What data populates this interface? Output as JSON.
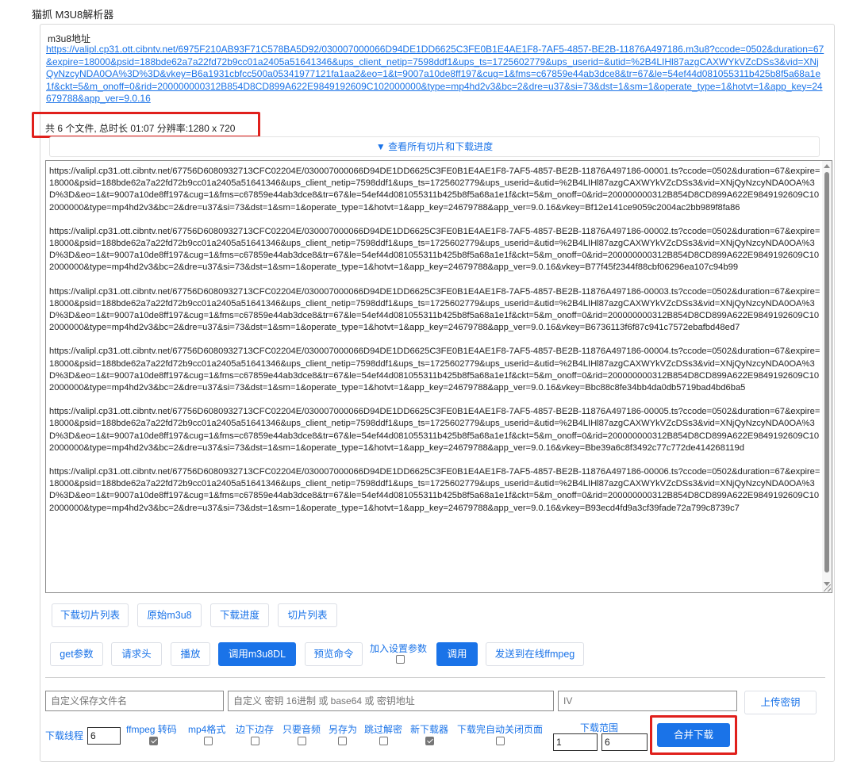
{
  "app": {
    "title": "猫抓 M3U8解析器"
  },
  "m3u8": {
    "label": "m3u8地址",
    "url": "https://valipl.cp31.ott.cibntv.net/6975F210AB93F71C578BA5D92/030007000066D94DE1DD6625C3FE0B1E4AE1F8-7AF5-4857-BE2B-11876A497186.m3u8?ccode=0502&duration=67&expire=18000&psid=188bde62a7a22fd72b9cc01a2405a51641346&ups_client_netip=7598ddf1&ups_ts=1725602779&ups_userid=&utid=%2B4LIHl87azgCAXWYkVZcDSs3&vid=XNjQyNzcyNDA0OA%3D%3D&vkey=B6a1931cbfcc500a05341977121fa1aa2&eo=1&t=9007a10de8ff197&cug=1&fms=c67859e44ab3dce8&tr=67&le=54ef44d081055311b425b8f5a68a1e1f&ckt=5&m_onoff=0&rid=200000000312B854D8CD899A622E9849192609C102000000&type=mp4hd2v3&bc=2&dre=u37&si=73&dst=1&sm=1&operate_type=1&hotvt=1&app_key=24679788&app_ver=9.0.16"
  },
  "summary": {
    "text": "共 6 个文件, 总时长 01:07 分辨率:1280 x 720"
  },
  "toggle": {
    "label": "▼ 查看所有切片和下载进度"
  },
  "segments": [
    "https://valipl.cp31.ott.cibntv.net/67756D6080932713CFC02204E/030007000066D94DE1DD6625C3FE0B1E4AE1F8-7AF5-4857-BE2B-11876A497186-00001.ts?ccode=0502&duration=67&expire=18000&psid=188bde62a7a22fd72b9cc01a2405a51641346&ups_client_netip=7598ddf1&ups_ts=1725602779&ups_userid=&utid=%2B4LIHl87azgCAXWYkVZcDSs3&vid=XNjQyNzcyNDA0OA%3D%3D&eo=1&t=9007a10de8ff197&cug=1&fms=c67859e44ab3dce8&tr=67&le=54ef44d081055311b425b8f5a68a1e1f&ckt=5&m_onoff=0&rid=200000000312B854D8CD899A622E9849192609C102000000&type=mp4hd2v3&bc=2&dre=u37&si=73&dst=1&sm=1&operate_type=1&hotvt=1&app_key=24679788&app_ver=9.0.16&vkey=Bf12e141ce9059c2004ac2bb989f8fa86",
    "https://valipl.cp31.ott.cibntv.net/67756D6080932713CFC02204E/030007000066D94DE1DD6625C3FE0B1E4AE1F8-7AF5-4857-BE2B-11876A497186-00002.ts?ccode=0502&duration=67&expire=18000&psid=188bde62a7a22fd72b9cc01a2405a51641346&ups_client_netip=7598ddf1&ups_ts=1725602779&ups_userid=&utid=%2B4LIHl87azgCAXWYkVZcDSs3&vid=XNjQyNzcyNDA0OA%3D%3D&eo=1&t=9007a10de8ff197&cug=1&fms=c67859e44ab3dce8&tr=67&le=54ef44d081055311b425b8f5a68a1e1f&ckt=5&m_onoff=0&rid=200000000312B854D8CD899A622E9849192609C102000000&type=mp4hd2v3&bc=2&dre=u37&si=73&dst=1&sm=1&operate_type=1&hotvt=1&app_key=24679788&app_ver=9.0.16&vkey=B77f45f2344f88cbf06296ea107c94b99",
    "https://valipl.cp31.ott.cibntv.net/67756D6080932713CFC02204E/030007000066D94DE1DD6625C3FE0B1E4AE1F8-7AF5-4857-BE2B-11876A497186-00003.ts?ccode=0502&duration=67&expire=18000&psid=188bde62a7a22fd72b9cc01a2405a51641346&ups_client_netip=7598ddf1&ups_ts=1725602779&ups_userid=&utid=%2B4LIHl87azgCAXWYkVZcDSs3&vid=XNjQyNzcyNDA0OA%3D%3D&eo=1&t=9007a10de8ff197&cug=1&fms=c67859e44ab3dce8&tr=67&le=54ef44d081055311b425b8f5a68a1e1f&ckt=5&m_onoff=0&rid=200000000312B854D8CD899A622E9849192609C102000000&type=mp4hd2v3&bc=2&dre=u37&si=73&dst=1&sm=1&operate_type=1&hotvt=1&app_key=24679788&app_ver=9.0.16&vkey=B6736113f6f87c941c7572ebafbd48ed7",
    "https://valipl.cp31.ott.cibntv.net/67756D6080932713CFC02204E/030007000066D94DE1DD6625C3FE0B1E4AE1F8-7AF5-4857-BE2B-11876A497186-00004.ts?ccode=0502&duration=67&expire=18000&psid=188bde62a7a22fd72b9cc01a2405a51641346&ups_client_netip=7598ddf1&ups_ts=1725602779&ups_userid=&utid=%2B4LIHl87azgCAXWYkVZcDSs3&vid=XNjQyNzcyNDA0OA%3D%3D&eo=1&t=9007a10de8ff197&cug=1&fms=c67859e44ab3dce8&tr=67&le=54ef44d081055311b425b8f5a68a1e1f&ckt=5&m_onoff=0&rid=200000000312B854D8CD899A622E9849192609C102000000&type=mp4hd2v3&bc=2&dre=u37&si=73&dst=1&sm=1&operate_type=1&hotvt=1&app_key=24679788&app_ver=9.0.16&vkey=Bbc88c8fe34bb4da0db5719bad4bd6ba5",
    "https://valipl.cp31.ott.cibntv.net/67756D6080932713CFC02204E/030007000066D94DE1DD6625C3FE0B1E4AE1F8-7AF5-4857-BE2B-11876A497186-00005.ts?ccode=0502&duration=67&expire=18000&psid=188bde62a7a22fd72b9cc01a2405a51641346&ups_client_netip=7598ddf1&ups_ts=1725602779&ups_userid=&utid=%2B4LIHl87azgCAXWYkVZcDSs3&vid=XNjQyNzcyNDA0OA%3D%3D&eo=1&t=9007a10de8ff197&cug=1&fms=c67859e44ab3dce8&tr=67&le=54ef44d081055311b425b8f5a68a1e1f&ckt=5&m_onoff=0&rid=200000000312B854D8CD899A622E9849192609C102000000&type=mp4hd2v3&bc=2&dre=u37&si=73&dst=1&sm=1&operate_type=1&hotvt=1&app_key=24679788&app_ver=9.0.16&vkey=Bbe39a6c8f3492c77c772de414268119d",
    "https://valipl.cp31.ott.cibntv.net/67756D6080932713CFC02204E/030007000066D94DE1DD6625C3FE0B1E4AE1F8-7AF5-4857-BE2B-11876A497186-00006.ts?ccode=0502&duration=67&expire=18000&psid=188bde62a7a22fd72b9cc01a2405a51641346&ups_client_netip=7598ddf1&ups_ts=1725602779&ups_userid=&utid=%2B4LIHl87azgCAXWYkVZcDSs3&vid=XNjQyNzcyNDA0OA%3D%3D&eo=1&t=9007a10de8ff197&cug=1&fms=c67859e44ab3dce8&tr=67&le=54ef44d081055311b425b8f5a68a1e1f&ckt=5&m_onoff=0&rid=200000000312B854D8CD899A622E9849192609C102000000&type=mp4hd2v3&bc=2&dre=u37&si=73&dst=1&sm=1&operate_type=1&hotvt=1&app_key=24679788&app_ver=9.0.16&vkey=B93ecd4fd9a3cf39fade72a799c8739c7"
  ],
  "view_buttons": {
    "download_segments": "下载切片列表",
    "raw_m3u8": "原始m3u8",
    "download_progress": "下载进度",
    "segment_list": "切片列表"
  },
  "action_buttons": {
    "get_params": "get参数",
    "request_headers": "请求头",
    "play": "播放",
    "call_m3u8dl": "调用m3u8DL",
    "preview_command": "预览命令",
    "add_settings_params": "加入设置参数",
    "invoke": "调用",
    "send_ffmpeg": "发送到在线ffmpeg"
  },
  "inputs": {
    "filename_placeholder": "自定义保存文件名",
    "key_placeholder": "自定义 密钥 16进制 或 base64 或 密钥地址",
    "iv_placeholder": "IV",
    "upload_key": "上传密钥"
  },
  "options": {
    "threads_label": "下载线程",
    "threads_value": "6",
    "ffmpeg_transcode": "ffmpeg 转码",
    "mp4_format": "mp4格式",
    "download_while_saving": "边下边存",
    "audio_only": "只要音频",
    "save_as": "另存为",
    "skip_decrypt": "跳过解密",
    "new_downloader": "新下载器",
    "auto_close": "下载完自动关闭页面",
    "range_label": "下载范围",
    "range_start": "1",
    "range_end": "6",
    "merge_download": "合并下载"
  },
  "colors": {
    "accent": "#1a73e8",
    "highlight": "#e0201c"
  }
}
